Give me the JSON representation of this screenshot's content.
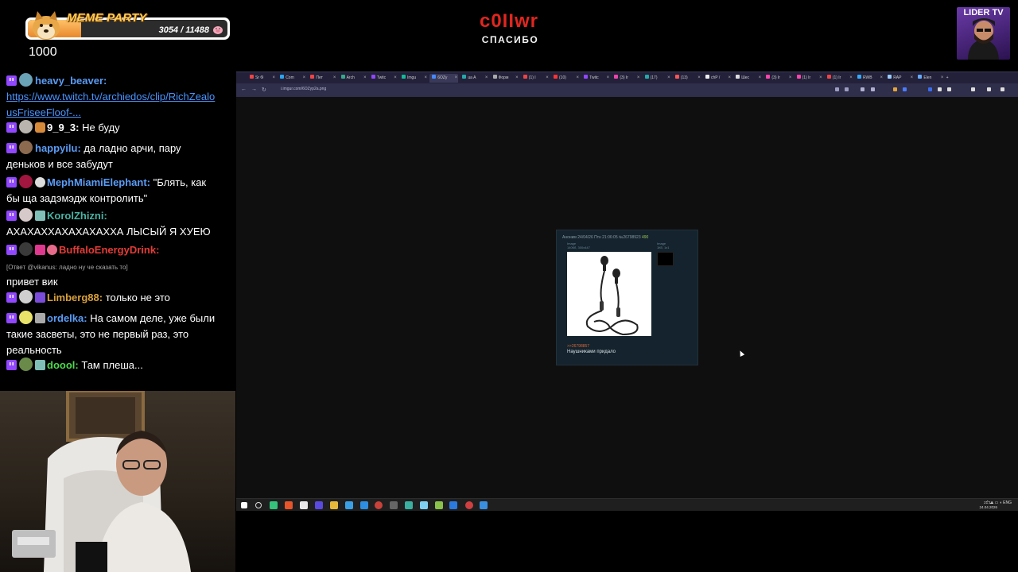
{
  "goal": {
    "title": "MEME PARTY",
    "current": 3054,
    "target": 11488,
    "count_text": "3054 / 11488",
    "amount": "1000",
    "icon_left": "doge-icon",
    "icon_right": "pig-icon"
  },
  "alert": {
    "name": "c0IIwr",
    "text": "СПАСИБО"
  },
  "channel_logo": {
    "text": "LIDER TV"
  },
  "chat": {
    "messages": [
      {
        "user": "heavy_beaver:",
        "user_color": "#5b9cf5",
        "text": "",
        "link": "https://www.twitch.tv/archiedos/clip/RichZealousFriseeFloof-...",
        "link_line1": "https://www.twitch.tv/archiedos/clip/RichZealo",
        "link_line2": "usFriseeFloof-..."
      },
      {
        "user": "9_9_3:",
        "user_color": "#ffffff",
        "text": "Не буду"
      },
      {
        "user": "happyilu:",
        "user_color": "#5b9cf5",
        "text": "да ладно арчи, пару",
        "text2": "деньков и все забудут"
      },
      {
        "user": "MephMiamiElephant:",
        "user_color": "#5b9cf5",
        "text": "\"Блять, как",
        "text2": "бы ща задэмэдж контролить\""
      },
      {
        "user": "KorolZhizni:",
        "user_color": "#4ab3a3",
        "text": "",
        "text2": "АХАХАХХАХАХАХАХХА ЛЫСЫЙ Я ХУЕЮ"
      },
      {
        "user": "BuffaloEnergyDrink:",
        "user_color": "#e53b36",
        "reply": "[Ответ @vikanus: ладно ну че сказать то]",
        "text2": "привет вик"
      },
      {
        "user": "Limberg88:",
        "user_color": "#d9a13b",
        "text": "только не это"
      },
      {
        "user": "ordelka:",
        "user_color": "#5b9cf5",
        "text": "На самом деле, уже были",
        "text2": "такие засветы, это не первый раз, это",
        "text3": "реальность"
      },
      {
        "user": "doool:",
        "user_color": "#4ddc4d",
        "text": "Там плеша..."
      }
    ]
  },
  "browser": {
    "tabs": [
      "Sr Ѳ",
      "Com",
      "Пет",
      "Arch",
      "Twitc",
      "Imgu",
      "6OZy",
      "ua A",
      "Форм",
      "(1) I",
      "(10)",
      "Twitc",
      "(3) Ir",
      "(17)",
      "(13)",
      "chP /",
      "Шес",
      "(3) Ir",
      "(1) Ir",
      "(1) Ir",
      "RWB",
      "RAP",
      "Elen"
    ],
    "active_tab": 6,
    "url": "i.imgur.com/6OZyp2a.png",
    "post": {
      "header": "Аноним 24/04/26 Птн 21:06:05 №26798923",
      "post_no": "490",
      "file1_label": "Image",
      "file1_size": "140Кб, 300x447",
      "file2_label": "Image",
      "file2_size": "1Кб, 1x1",
      "reply_link": ">>26798857",
      "text": "Наушниками придало"
    },
    "taskbar": {
      "lang": "ENG",
      "time": "21:13",
      "date": "24.04.2026"
    }
  }
}
